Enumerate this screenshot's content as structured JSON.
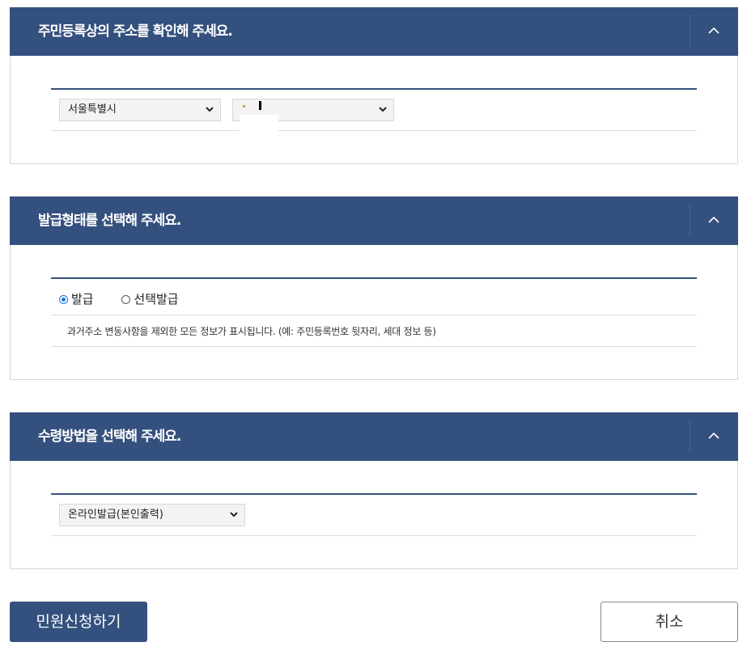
{
  "address_section": {
    "title": "주민등록상의 주소를 확인해 주세요.",
    "toggle_icon": "chevron-up-icon",
    "city_select": {
      "selected": "서울특별시"
    },
    "district_select": {
      "selected": ""
    }
  },
  "issue_type_section": {
    "title": "발급형태를 선택해 주세요.",
    "toggle_icon": "chevron-up-icon",
    "options": [
      {
        "label": "발급",
        "checked": true
      },
      {
        "label": "선택발급",
        "checked": false
      }
    ],
    "note": "과거주소 변동사항을 제외한 모든 정보가 표시됩니다. (예: 주민등록번호 뒷자리, 세대 정보 등)"
  },
  "receive_section": {
    "title": "수령방법을 선택해 주세요.",
    "toggle_icon": "chevron-up-icon",
    "method_select": {
      "selected": "온라인발급(본인출력)"
    }
  },
  "actions": {
    "submit_label": "민원신청하기",
    "cancel_label": "취소"
  },
  "colors": {
    "header_bg": "#34507e",
    "header_text": "#ffffff",
    "radio_accent": "#1a73e8"
  }
}
